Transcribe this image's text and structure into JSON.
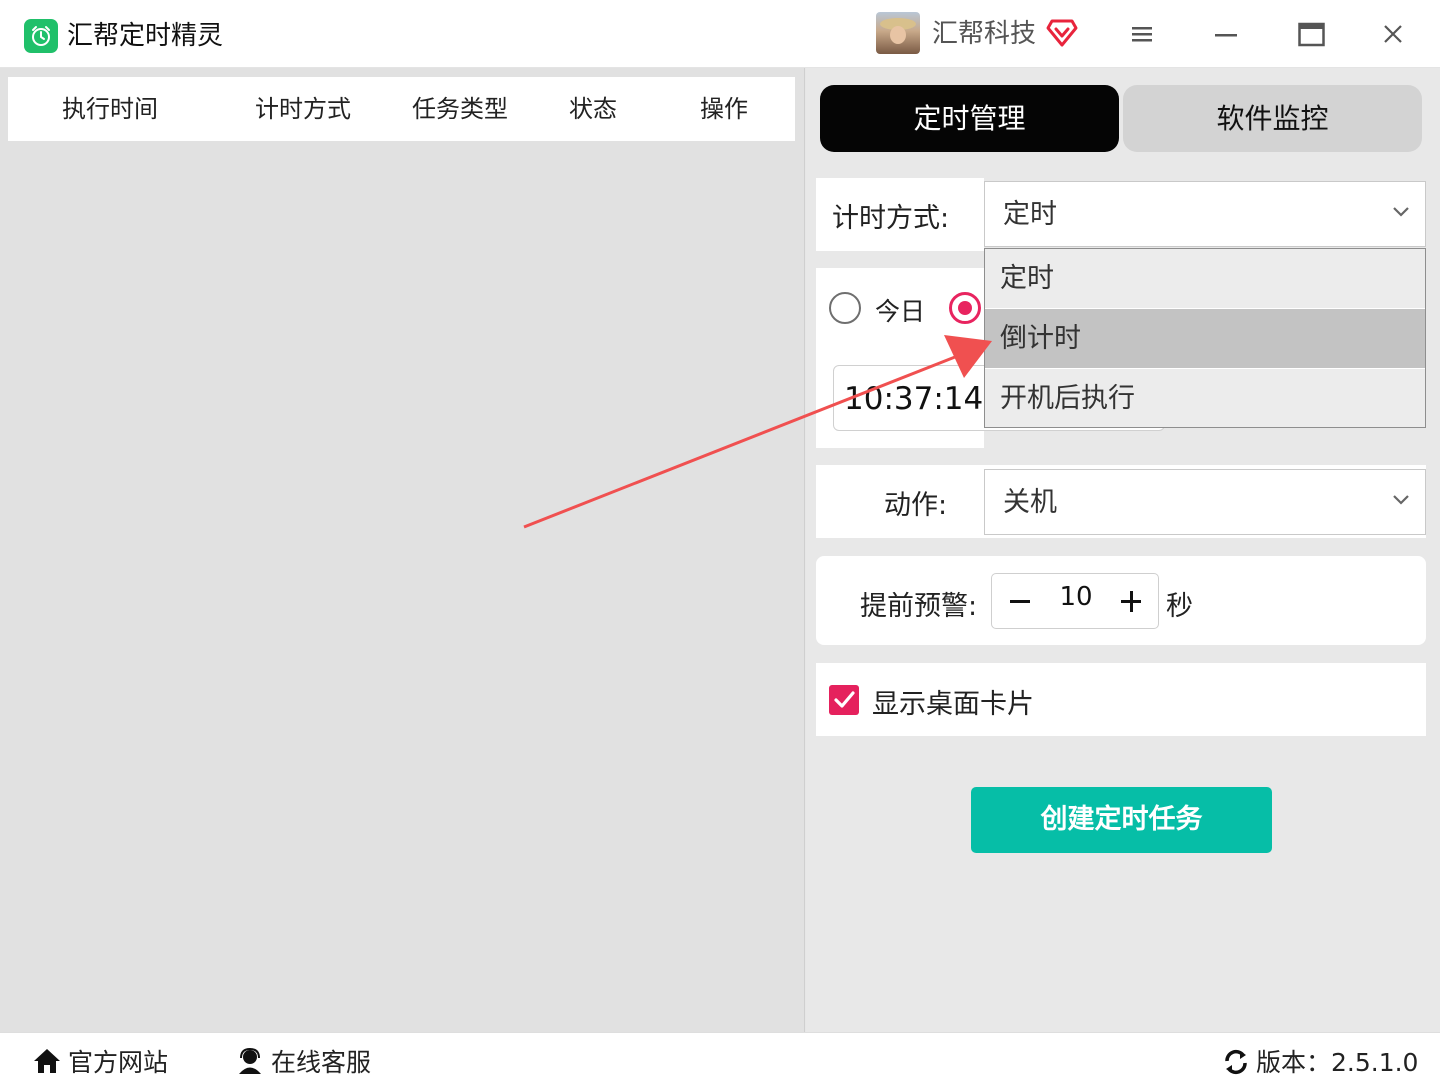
{
  "app": {
    "title": "汇帮定时精灵",
    "company": "汇帮科技"
  },
  "table": {
    "columns": [
      "执行时间",
      "计时方式",
      "任务类型",
      "状态",
      "操作"
    ]
  },
  "tabs": {
    "active": "定时管理",
    "inactive": "软件监控"
  },
  "timing": {
    "label": "计时方式:",
    "selected": "定时",
    "options": [
      "定时",
      "倒计时",
      "开机后执行"
    ],
    "highlighted_index": 1
  },
  "date": {
    "today_label": "今日",
    "today_selected": false,
    "other_selected": true,
    "time_value": "10:37:14"
  },
  "action": {
    "label": "动作:",
    "selected": "关机"
  },
  "warning": {
    "label": "提前预警:",
    "value": "10",
    "unit": "秒"
  },
  "desktop_card": {
    "label": "显示桌面卡片",
    "checked": true
  },
  "create_button": {
    "label": "创建定时任务"
  },
  "footer": {
    "website": "官方网站",
    "support": "在线客服",
    "version": "版本：2.5.1.0"
  },
  "colors": {
    "accent_pink": "#e8245f",
    "button_teal": "#06bea7",
    "logo_green": "#20c06a",
    "annotation_arrow": "#f05050"
  }
}
